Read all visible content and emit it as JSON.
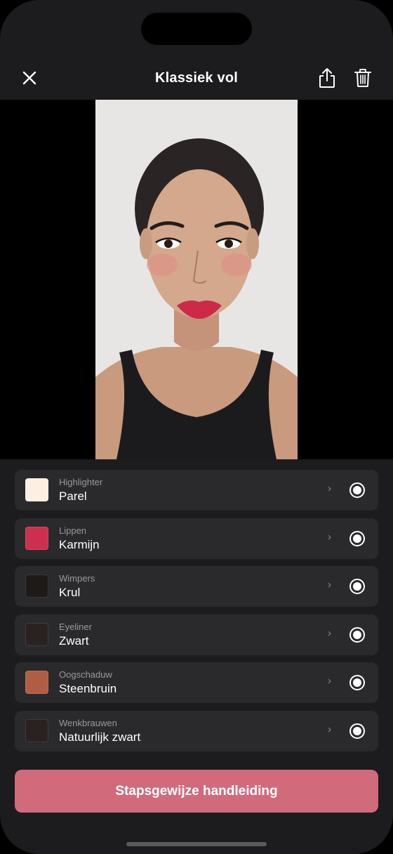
{
  "header": {
    "title": "Klassiek vol"
  },
  "icons": {
    "close": "close-icon",
    "share": "share-icon",
    "trash": "trash-icon"
  },
  "items": [
    {
      "category": "Highlighter",
      "value": "Parel",
      "color": "#fdf0e3"
    },
    {
      "category": "Lippen",
      "value": "Karmijn",
      "color": "#cc2f4f"
    },
    {
      "category": "Wimpers",
      "value": "Krul",
      "color": "#1e1a18"
    },
    {
      "category": "Eyeliner",
      "value": "Zwart",
      "color": "#2a2220"
    },
    {
      "category": "Oogschaduw",
      "value": "Steenbruin",
      "color": "#b15d44"
    },
    {
      "category": "Wenkbrauwen",
      "value": "Natuurlijk zwart",
      "color": "#2a2220"
    }
  ],
  "cta": {
    "label": "Stapsgewijze handleiding",
    "color": "#d16b7c"
  }
}
